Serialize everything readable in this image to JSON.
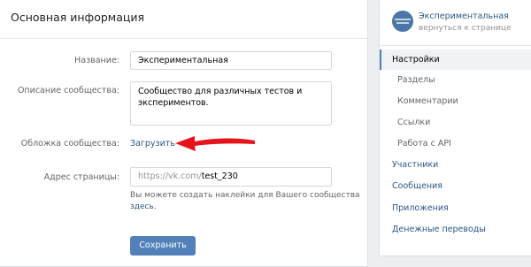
{
  "main": {
    "title": "Основная информация",
    "name_label": "Название:",
    "name_value": "Экспериментальная",
    "description_label": "Описание сообщества:",
    "description_value": "Сообщество для различных тестов и экспериментов.",
    "cover_label": "Обложка сообщества:",
    "cover_upload": "Загрузить",
    "address_label": "Адрес страницы:",
    "address_prefix": "https://vk.com/",
    "address_value": "test_230",
    "hint_text": "Вы можете создать наклейки для Вашего сообщества",
    "hint_link": "здесь",
    "hint_end": ".",
    "save_label": "Сохранить"
  },
  "side": {
    "community_name": "Экспериментальная",
    "community_back": "вернуться к странице",
    "menu": [
      {
        "label": "Настройки"
      },
      {
        "label": "Разделы"
      },
      {
        "label": "Комментарии"
      },
      {
        "label": "Ссылки"
      },
      {
        "label": "Работа с API"
      },
      {
        "label": "Участники"
      },
      {
        "label": "Сообщения"
      },
      {
        "label": "Приложения"
      },
      {
        "label": "Денежные переводы"
      }
    ]
  },
  "colors": {
    "accent": "#5181b8",
    "link": "#2a5885",
    "arrow": "#e8121b"
  }
}
